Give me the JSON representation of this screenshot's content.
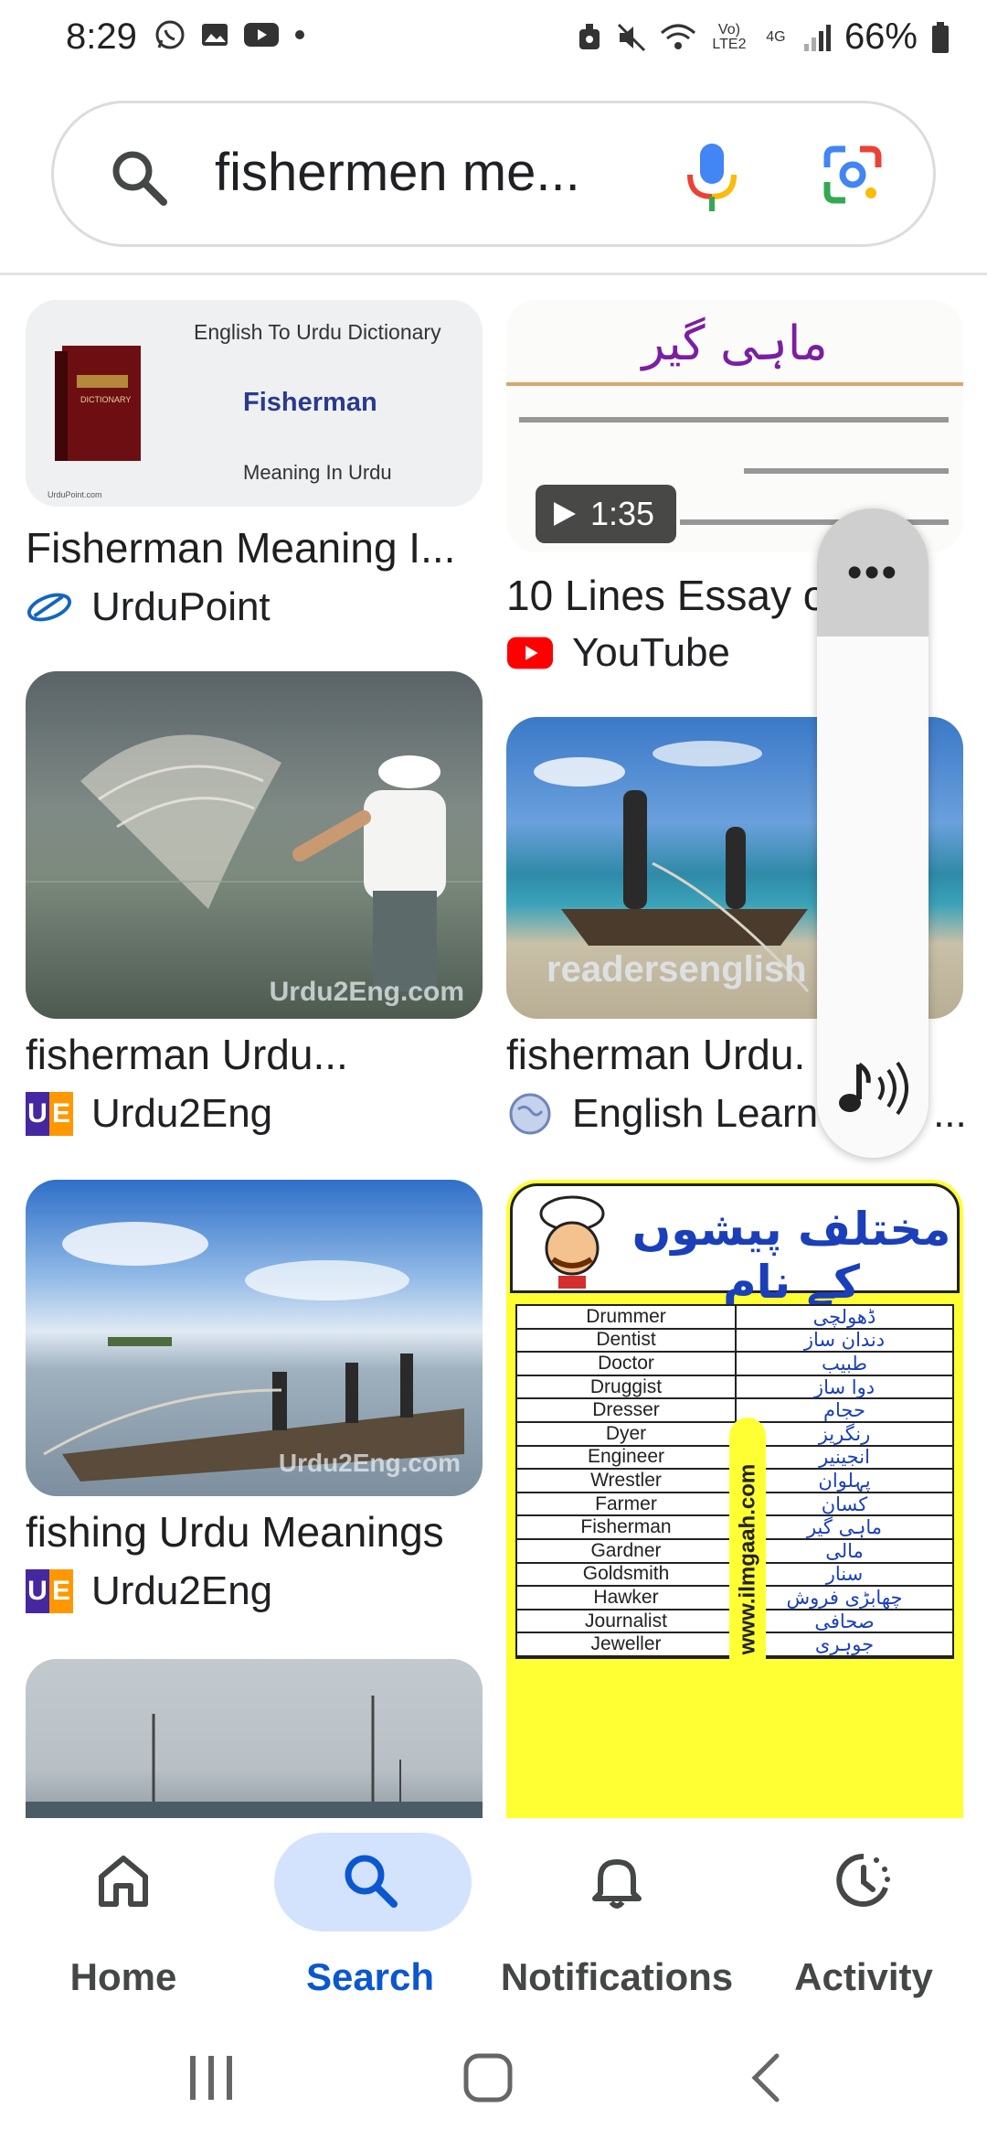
{
  "status_bar": {
    "time": "8:29",
    "volte": "Vo) LTE2",
    "net": "4G",
    "battery": "66%"
  },
  "search": {
    "query": "fishermen me...",
    "icons": [
      "search-icon",
      "mic-icon",
      "lens-icon"
    ]
  },
  "results": [
    {
      "title": "Fisherman Meaning I...",
      "source": "UrduPoint",
      "thumb": {
        "heading": "English To Urdu Dictionary",
        "word": "Fisherman",
        "sub": "Meaning In Urdu",
        "book": "DICTIONARY",
        "footer": "UrduPoint.com"
      }
    },
    {
      "title": "10 Lines Essay o",
      "source": "YouTube",
      "duration": "1:35",
      "thumb": {
        "heading": "ماہی گیر"
      }
    },
    {
      "title": "fisherman Urdu...",
      "source": "Urdu2Eng",
      "thumb": {
        "watermark": "Urdu2Eng.com"
      }
    },
    {
      "title": "fisherman Urdu.",
      "source": "English Learn",
      "source_suffix": "...",
      "thumb": {
        "watermark": "readersenglish"
      }
    },
    {
      "title": "fishing Urdu Meanings",
      "source": "Urdu2Eng",
      "thumb": {
        "watermark": "Urdu2Eng.com"
      }
    },
    {
      "thumb": {
        "heading": "مختلف پیشوں کے نام",
        "side_text": "www.ilmgaah.com",
        "rows": [
          [
            "Drummer",
            "ڈھولچی"
          ],
          [
            "Dentist",
            "دندان ساز"
          ],
          [
            "Doctor",
            "طبیب"
          ],
          [
            "Druggist",
            "دوا ساز"
          ],
          [
            "Dresser",
            "حجام"
          ],
          [
            "Dyer",
            "رنگریز"
          ],
          [
            "Engineer",
            "انجینیر"
          ],
          [
            "Wrestler",
            "پہلوان"
          ],
          [
            "Farmer",
            "کسان"
          ],
          [
            "Fisherman",
            "ماہی گیر"
          ],
          [
            "Gardner",
            "مالی"
          ],
          [
            "Goldsmith",
            "سنار"
          ],
          [
            "Hawker",
            "چھابڑی فروش"
          ],
          [
            "Journalist",
            "صحافی"
          ],
          [
            "Jeweller",
            "جوہری"
          ]
        ]
      }
    }
  ],
  "side_panel": {
    "menu": "•••"
  },
  "bottom_nav": [
    {
      "label": "Home",
      "icon": "home-icon"
    },
    {
      "label": "Search",
      "icon": "search-icon",
      "active": true
    },
    {
      "label": "Notifications",
      "icon": "bell-icon"
    },
    {
      "label": "Activity",
      "icon": "activity-icon"
    }
  ],
  "colors": {
    "accent": "#0b57d0",
    "active_pill": "#d3e3fd",
    "youtube_red": "#ff0000"
  }
}
